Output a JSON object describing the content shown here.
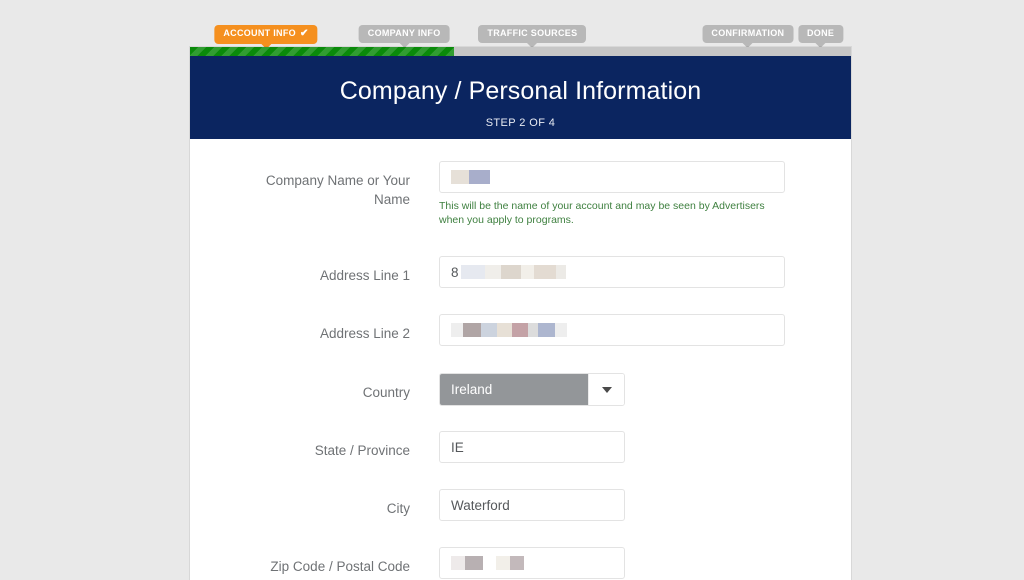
{
  "wizard": {
    "steps": [
      {
        "label": "ACCOUNT INFO",
        "state": "active",
        "check": "✔",
        "icon": "check-icon"
      },
      {
        "label": "COMPANY INFO",
        "state": "inactive",
        "check": "",
        "icon": ""
      },
      {
        "label": "TRAFFIC SOURCES",
        "state": "inactive",
        "check": "",
        "icon": ""
      },
      {
        "label": "CONFIRMATION",
        "state": "inactive",
        "check": "",
        "icon": ""
      },
      {
        "label": "DONE",
        "state": "inactive",
        "check": "",
        "icon": ""
      }
    ],
    "progress_percent": 40,
    "colors": {
      "active_badge": "#f5901f",
      "inactive_badge": "#b8b8b8",
      "progress_fill": "#0a8a0a",
      "progress_track": "#c6c6c6",
      "header_navy": "#0b2560",
      "help_text_green": "#3f8040",
      "select_highlight": "#939699"
    }
  },
  "header": {
    "title": "Company / Personal Information",
    "subtitle": "STEP 2 OF 4"
  },
  "form": {
    "company_name": {
      "label": "Company Name or Your Name",
      "value": "",
      "redacted": true,
      "help": "This will be the name of your account and may be seen by Advertisers when you apply to programs."
    },
    "address1": {
      "label": "Address Line 1",
      "value": "8",
      "redacted": true
    },
    "address2": {
      "label": "Address Line 2",
      "value": "",
      "redacted": true
    },
    "country": {
      "label": "Country",
      "value": "Ireland",
      "arrow_icon": "chevron-down-icon"
    },
    "state": {
      "label": "State / Province",
      "value": "IE"
    },
    "city": {
      "label": "City",
      "value": "Waterford"
    },
    "zip": {
      "label": "Zip Code / Postal Code",
      "value": "",
      "redacted": true
    }
  }
}
